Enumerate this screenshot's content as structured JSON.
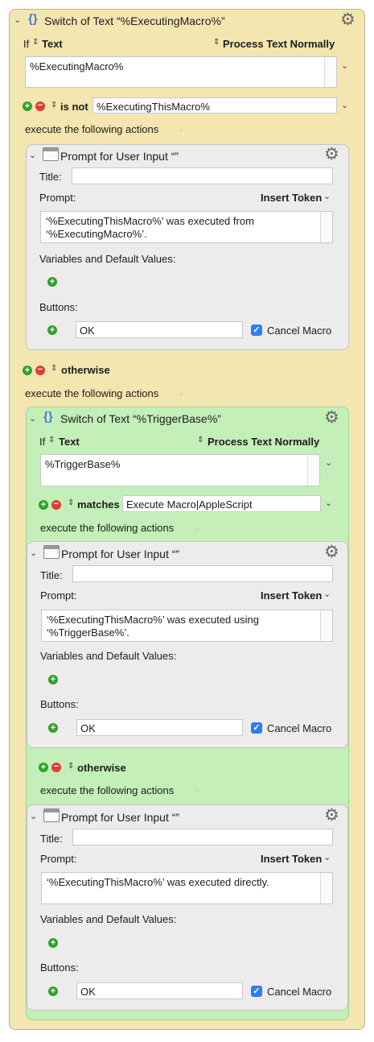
{
  "outer": {
    "title": "Switch of Text “%ExecutingMacro%”",
    "if_label": "If",
    "source_label": "Text",
    "process_label": "Process Text Normally",
    "text_value": "%ExecutingMacro%",
    "case1_op": "is not",
    "case1_value": "%ExecutingThisMacro%",
    "case1_exec": "execute the following actions",
    "otherwise_label": "otherwise",
    "otherwise_exec": "execute the following actions"
  },
  "prompt1": {
    "title": "Prompt for User Input “”",
    "title_label": "Title:",
    "title_value": "",
    "prompt_label": "Prompt:",
    "insert_token": "Insert Token",
    "prompt_line1": "‘%ExecutingThisMacro%’ was executed from",
    "prompt_line2": "‘%ExecutingMacro%’.",
    "vars_label": "Variables and Default Values:",
    "buttons_label": "Buttons:",
    "ok_value": "OK",
    "cancel_label": "Cancel Macro"
  },
  "inner": {
    "title": "Switch of Text “%TriggerBase%”",
    "if_label": "If",
    "source_label": "Text",
    "process_label": "Process Text Normally",
    "text_value": "%TriggerBase%",
    "case1_op": "matches",
    "case1_value": "Execute Macro|AppleScript",
    "case1_exec": "execute the following actions",
    "otherwise_label": "otherwise",
    "otherwise_exec": "execute the following actions"
  },
  "prompt2": {
    "title": "Prompt for User Input “”",
    "title_label": "Title:",
    "title_value": "",
    "prompt_label": "Prompt:",
    "insert_token": "Insert Token",
    "prompt_line1": "‘%ExecutingThisMacro%’ was executed using",
    "prompt_line2": "‘%TriggerBase%’.",
    "vars_label": "Variables and Default Values:",
    "buttons_label": "Buttons:",
    "ok_value": "OK",
    "cancel_label": "Cancel Macro"
  },
  "prompt3": {
    "title": "Prompt for User Input “”",
    "title_label": "Title:",
    "title_value": "",
    "prompt_label": "Prompt:",
    "insert_token": "Insert Token",
    "prompt_line1": "‘%ExecutingThisMacro%’ was executed directly.",
    "vars_label": "Variables and Default Values:",
    "buttons_label": "Buttons:",
    "ok_value": "OK",
    "cancel_label": "Cancel Macro"
  },
  "icons": {
    "collapse": "chevron-down-icon",
    "switch": "switch-braces-icon",
    "prompt": "window-icon",
    "gear": "gear-icon",
    "add": "add-circle-icon",
    "remove": "remove-circle-icon",
    "popup": "up-down-arrows-icon",
    "checkbox": "checkmark-icon"
  },
  "colors": {
    "switch_bg": "#f3e6b0",
    "nested_bg": "#c4efb8",
    "action_bg": "#ececec",
    "checkbox": "#2f7cf6",
    "add": "#33a02c",
    "remove": "#e03b3b",
    "braces": "#4a78d6"
  }
}
